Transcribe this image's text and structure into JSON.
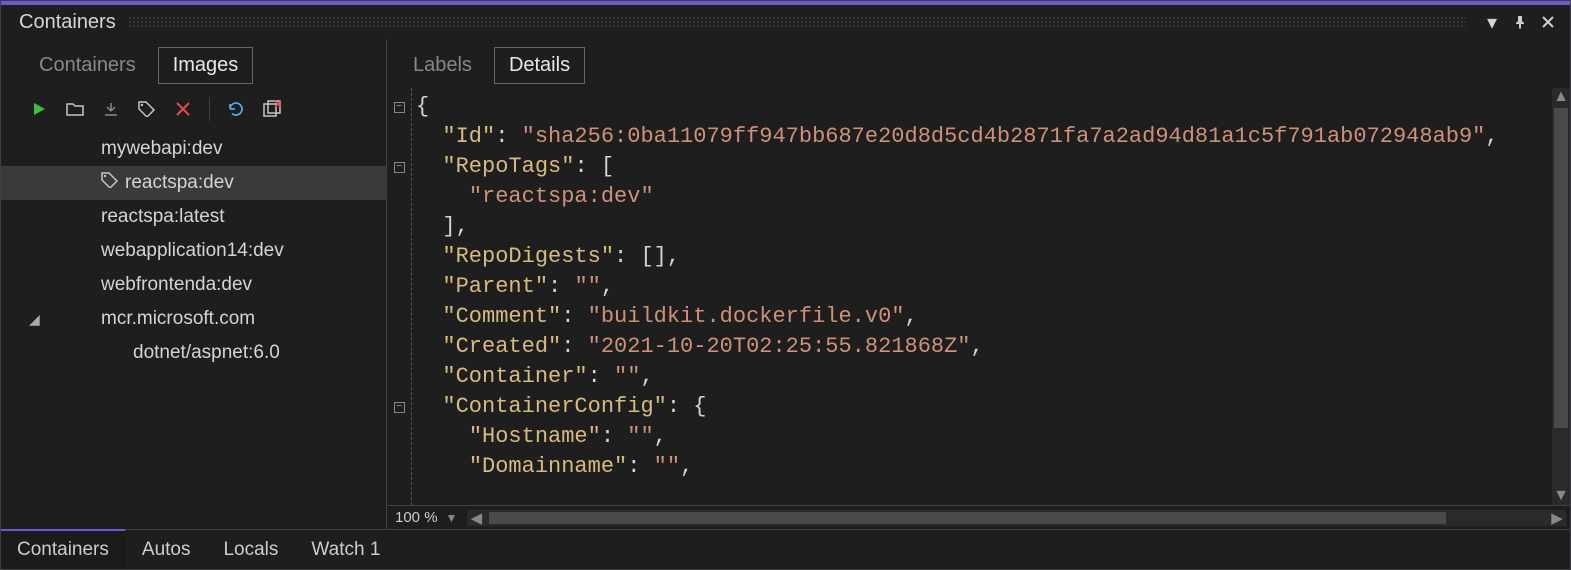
{
  "window": {
    "title": "Containers"
  },
  "title_controls": {
    "dropdown": "▼",
    "pin": "pin",
    "close": "×"
  },
  "left": {
    "tabs": {
      "containers": "Containers",
      "images": "Images",
      "active": "Images"
    },
    "toolbar": {
      "play": "Run",
      "openFolder": "Open",
      "download": "Pull",
      "tag": "Tag",
      "delete": "Delete",
      "refresh": "Refresh",
      "prune": "Prune"
    },
    "tree": [
      {
        "label": "mywebapi:dev",
        "level": "child",
        "selected": false,
        "icon": "none"
      },
      {
        "label": "reactspa:dev",
        "level": "child",
        "selected": true,
        "icon": "tag"
      },
      {
        "label": "reactspa:latest",
        "level": "child",
        "selected": false,
        "icon": "none"
      },
      {
        "label": "webapplication14:dev",
        "level": "child",
        "selected": false,
        "icon": "none"
      },
      {
        "label": "webfrontenda:dev",
        "level": "child",
        "selected": false,
        "icon": "none"
      },
      {
        "label": "mcr.microsoft.com",
        "level": "root",
        "selected": false,
        "icon": "expander"
      },
      {
        "label": "dotnet/aspnet:6.0",
        "level": "grandchild",
        "selected": false,
        "icon": "none"
      }
    ]
  },
  "right": {
    "tabs": {
      "labels": "Labels",
      "details": "Details",
      "active": "Details"
    },
    "zoom": "100 %"
  },
  "details_json": {
    "Id": "sha256:0ba11079ff947bb687e20d8d5cd4b2871fa7a2ad94d81a1c5f791ab072948ab9",
    "RepoTags": [
      "reactspa:dev"
    ],
    "RepoDigests": [],
    "Parent": "",
    "Comment": "buildkit.dockerfile.v0",
    "Created": "2021-10-20T02:25:55.821868Z",
    "Container": "",
    "ContainerConfig": {
      "Hostname": "",
      "Domainname": ""
    }
  },
  "bottom_tabs": [
    "Containers",
    "Autos",
    "Locals",
    "Watch 1"
  ],
  "bottom_active": "Containers"
}
